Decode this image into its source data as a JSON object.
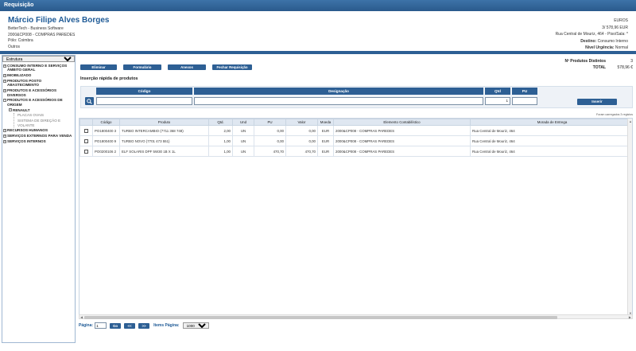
{
  "app": {
    "title": "Requisição"
  },
  "header": {
    "name": "Márcio Filipe Alves Borges",
    "company": "BetterTech - Business Software",
    "cost_center": "2000&CP008 - COMPRAS PAREDES",
    "pole": "Pólo: Coimbra",
    "other": "Outros",
    "currency": "EUROS",
    "total": "3/ 578,96 EUR",
    "address": "Rua Central de Mouriz, 464 - Piso/Sala: *",
    "destino_label": "Destino:",
    "destino_value": "Consumo Interno",
    "urgencia_label": "Nível Urgência:",
    "urgencia_value": "Normal"
  },
  "sidebar": {
    "dropdown_value": "Estrutura",
    "items": [
      {
        "label": "CONSUMO INTERNO E SERVIÇOS ÂMBITO GERAL",
        "pm": "+"
      },
      {
        "label": "IMOBILIZADO",
        "pm": "+"
      },
      {
        "label": "PRODUTOS POSTO ABASTECIMENTO",
        "pm": "+"
      },
      {
        "label": "PRODUTOS E ACESSÓRIOS DIVERSOS",
        "pm": "+"
      },
      {
        "label": "PRODUTOS E ACESSÓRIOS DE ORIGEM",
        "pm": "−"
      },
      {
        "label": "RENAULT",
        "pm": "−"
      },
      {
        "label": "PLACAS OVAIS"
      },
      {
        "label": "SISTEMA DE DIREÇÃO E VOLANTE"
      },
      {
        "label": "RECURSOS HUMANOS",
        "pm": "+"
      },
      {
        "label": "SERVIÇOS EXTERNOS PARA VENDA",
        "pm": "+"
      },
      {
        "label": "SERVIÇOS INTERNOS",
        "pm": "+"
      }
    ]
  },
  "toolbar": {
    "eliminar": "Eliminar",
    "formulario": "Formulário",
    "anexos": "Anexos",
    "fechar": "Fechar Requisição"
  },
  "stats": {
    "distinct_label": "Nº Produtos Distintos",
    "distinct_value": "3",
    "total_label": "TOTAL",
    "total_value": "578,96 €"
  },
  "quick_insert": {
    "title": "Inserção rápida de produtos",
    "col_codigo": "Código",
    "col_designacao": "Designação",
    "col_qtd": "Qtd",
    "col_pu": "PU",
    "qtd_value": "1",
    "insert_label": "Inserir"
  },
  "grid": {
    "loaded_text": "Foram carregados 3 registos",
    "columns": [
      "",
      "Código",
      "Produto",
      "Qtd.",
      "Und",
      "PU",
      "Valor",
      "Moeda",
      "Elemento Contabilístico",
      "Morada de Entrega"
    ],
    "rows": [
      {
        "code": "PO1800400 3",
        "product": "TURBO INTERCAMBIO (7711 368 748)",
        "qty": "2,00",
        "unit": "UN",
        "pu": "0,00",
        "valor": "0,00",
        "moeda": "EUR",
        "elemento": "2000&CP008 - COMPRAS PAREDES",
        "morada": "Rua Central de Mouriz, 464"
      },
      {
        "code": "PO1800400 9",
        "product": "TURBO NOVO (7701 473 551)",
        "qty": "1,00",
        "unit": "UN",
        "pu": "0,00",
        "valor": "0,00",
        "moeda": "EUR",
        "elemento": "2000&CP008 - COMPRAS PAREDES",
        "morada": "Rua Central de Mouriz, 464"
      },
      {
        "code": "PO0200106 2",
        "product": "ELF SOLARIS DPF 5W30 1B X 1L",
        "qty": "1,00",
        "unit": "UN",
        "pu": "470,70",
        "valor": "470,70",
        "moeda": "EUR",
        "elemento": "2000&CP008 - COMPRAS PAREDES",
        "morada": "Rua Central de Mouriz, 464"
      }
    ]
  },
  "pager": {
    "label": "Página:",
    "page_value": "1",
    "go": "Go",
    "prev": "<<",
    "next": ">>",
    "items_label": "Items Página:",
    "items_value": "1000"
  }
}
